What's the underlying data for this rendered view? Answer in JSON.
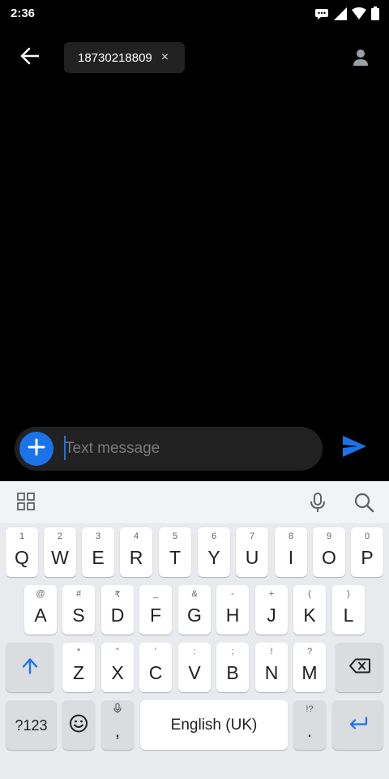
{
  "status_bar": {
    "time": "2:36",
    "icons": [
      "message-notification-icon",
      "signal-icon",
      "wifi-icon",
      "battery-icon"
    ]
  },
  "header": {
    "back_icon": "arrow-left-icon",
    "recipient_chip": {
      "number": "18730218809",
      "remove_icon": "×"
    },
    "contact_icon": "person-icon"
  },
  "composer": {
    "add_icon": "plus-icon",
    "placeholder": "Text message",
    "value": "",
    "send_icon": "send-icon"
  },
  "keyboard": {
    "toolbar": {
      "left_icon": "grid-icon",
      "right_icons": [
        "mic-icon",
        "search-icon"
      ]
    },
    "row1": [
      {
        "key": "Q",
        "hint": "1"
      },
      {
        "key": "W",
        "hint": "2"
      },
      {
        "key": "E",
        "hint": "3"
      },
      {
        "key": "R",
        "hint": "4"
      },
      {
        "key": "T",
        "hint": "5"
      },
      {
        "key": "Y",
        "hint": "6"
      },
      {
        "key": "U",
        "hint": "7"
      },
      {
        "key": "I",
        "hint": "8"
      },
      {
        "key": "O",
        "hint": "9"
      },
      {
        "key": "P",
        "hint": "0"
      }
    ],
    "row2": [
      {
        "key": "A",
        "hint": "@"
      },
      {
        "key": "S",
        "hint": "#"
      },
      {
        "key": "D",
        "hint": "₹"
      },
      {
        "key": "F",
        "hint": "_"
      },
      {
        "key": "G",
        "hint": "&"
      },
      {
        "key": "H",
        "hint": "-"
      },
      {
        "key": "J",
        "hint": "+"
      },
      {
        "key": "K",
        "hint": "("
      },
      {
        "key": "L",
        "hint": ")"
      }
    ],
    "row3": [
      {
        "key": "Z",
        "hint": "*"
      },
      {
        "key": "X",
        "hint": "\""
      },
      {
        "key": "C",
        "hint": "'"
      },
      {
        "key": "V",
        "hint": ":"
      },
      {
        "key": "B",
        "hint": ";"
      },
      {
        "key": "N",
        "hint": "!"
      },
      {
        "key": "M",
        "hint": "?"
      }
    ],
    "symbols_label": "?123",
    "comma": ",",
    "space_label": "English (UK)",
    "period": ".",
    "period_hint": "!?",
    "accent_color": "#1a73e8"
  }
}
